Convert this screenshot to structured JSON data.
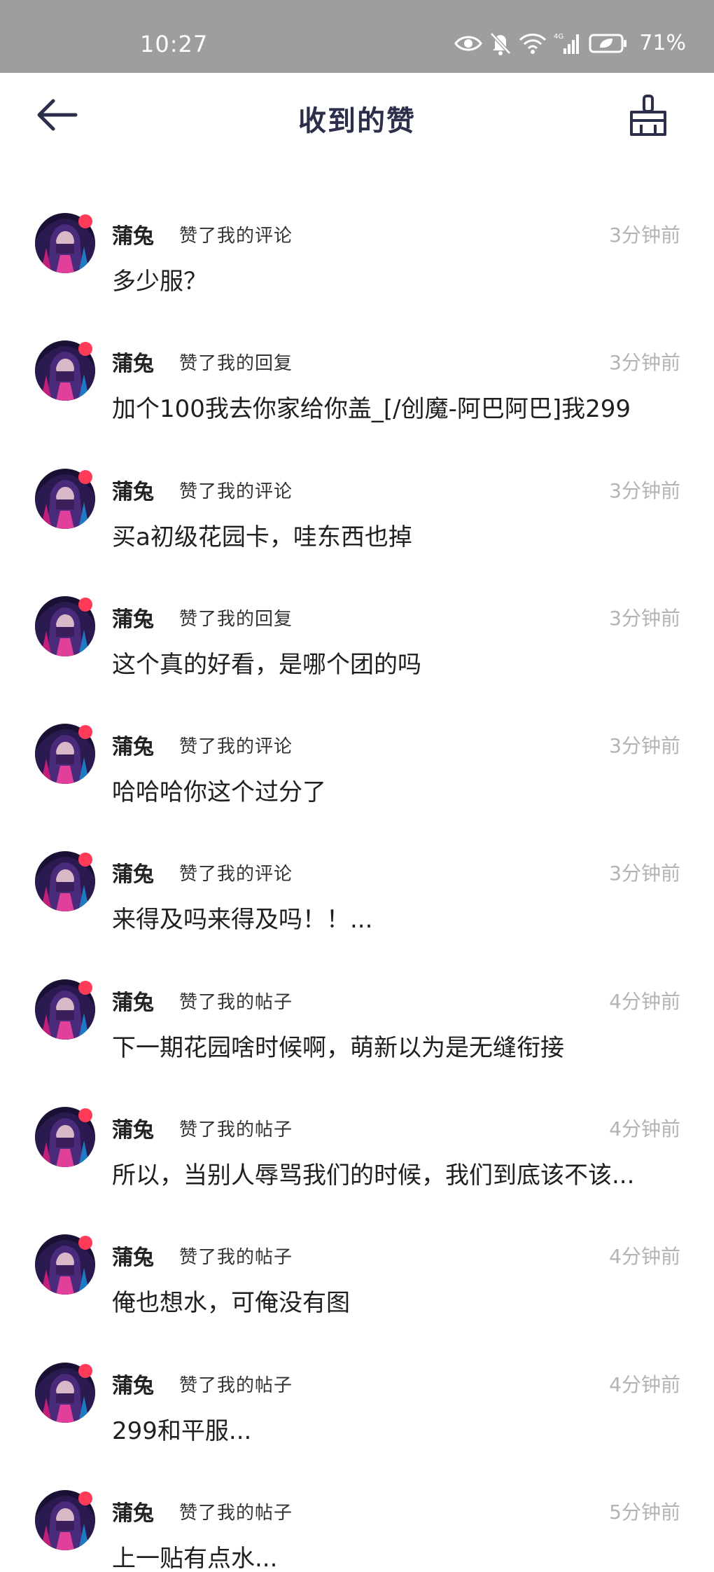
{
  "status_bar": {
    "time": "10:27",
    "battery": "71%",
    "icons": [
      "eye-icon",
      "mute-bell-icon",
      "wifi-icon",
      "4g-signal-icon",
      "battery-icon"
    ]
  },
  "header": {
    "title": "收到的赞",
    "back_icon": "back-arrow-icon",
    "clear_icon": "broom-icon"
  },
  "colors": {
    "title": "#2c2f4a",
    "badge": "#ff3b57",
    "time": "#b3b3b3"
  },
  "list": [
    {
      "name": "蒲兔",
      "action": "赞了我的评论",
      "time": "3分钟前",
      "content": "多少服？"
    },
    {
      "name": "蒲兔",
      "action": "赞了我的回复",
      "time": "3分钟前",
      "content": "加个100我去你家给你盖_[/创魔-阿巴阿巴]我299"
    },
    {
      "name": "蒲兔",
      "action": "赞了我的评论",
      "time": "3分钟前",
      "content": "买a初级花园卡，哇东西也掉"
    },
    {
      "name": "蒲兔",
      "action": "赞了我的回复",
      "time": "3分钟前",
      "content": "这个真的好看，是哪个团的吗"
    },
    {
      "name": "蒲兔",
      "action": "赞了我的评论",
      "time": "3分钟前",
      "content": "哈哈哈你这个过分了"
    },
    {
      "name": "蒲兔",
      "action": "赞了我的评论",
      "time": "3分钟前",
      "content": "来得及吗来得及吗！！..."
    },
    {
      "name": "蒲兔",
      "action": "赞了我的帖子",
      "time": "4分钟前",
      "content": "下一期花园啥时候啊，萌新以为是无缝衔接"
    },
    {
      "name": "蒲兔",
      "action": "赞了我的帖子",
      "time": "4分钟前",
      "content": "所以，当别人辱骂我们的时候，我们到底该不该..."
    },
    {
      "name": "蒲兔",
      "action": "赞了我的帖子",
      "time": "4分钟前",
      "content": "俺也想水，可俺没有图"
    },
    {
      "name": "蒲兔",
      "action": "赞了我的帖子",
      "time": "4分钟前",
      "content": "299和平服..."
    },
    {
      "name": "蒲兔",
      "action": "赞了我的帖子",
      "time": "5分钟前",
      "content": "上一贴有点水..."
    }
  ]
}
